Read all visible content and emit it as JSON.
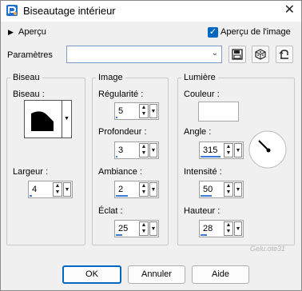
{
  "window": {
    "title": "Biseautage intérieur"
  },
  "preview": {
    "toggle_label": "Aperçu",
    "image_preview_label": "Aperçu de l'image",
    "image_preview_checked": true
  },
  "params": {
    "label": "Paramètres",
    "value": ""
  },
  "biseau": {
    "group_label": "Biseau",
    "shape_label": "Biseau :",
    "width_label": "Largeur :",
    "width_value": "4",
    "width_level": 0.1
  },
  "image": {
    "group_label": "Image",
    "regularity_label": "Régularité :",
    "regularity_value": "5",
    "regularity_level": 0.05,
    "depth_label": "Profondeur :",
    "depth_value": "3",
    "depth_level": 0.05,
    "ambiance_label": "Ambiance :",
    "ambiance_value": "2",
    "ambiance_level": 0.55,
    "eclat_label": "Éclat :",
    "eclat_value": "25",
    "eclat_level": 0.3
  },
  "lumiere": {
    "group_label": "Lumière",
    "color_label": "Couleur :",
    "color": "#ffffff",
    "angle_label": "Angle :",
    "angle_value": "315",
    "angle_level": 0.88,
    "intensity_label": "Intensité :",
    "intensity_value": "50",
    "intensity_level": 0.5,
    "height_label": "Hauteur :",
    "height_value": "28",
    "height_level": 0.28
  },
  "buttons": {
    "ok": "OK",
    "cancel": "Annuler",
    "help": "Aide"
  },
  "watermark": "Gelu.ote31",
  "colors": {
    "accent": "#0067c0",
    "level_bar": "#3c7bd6"
  }
}
